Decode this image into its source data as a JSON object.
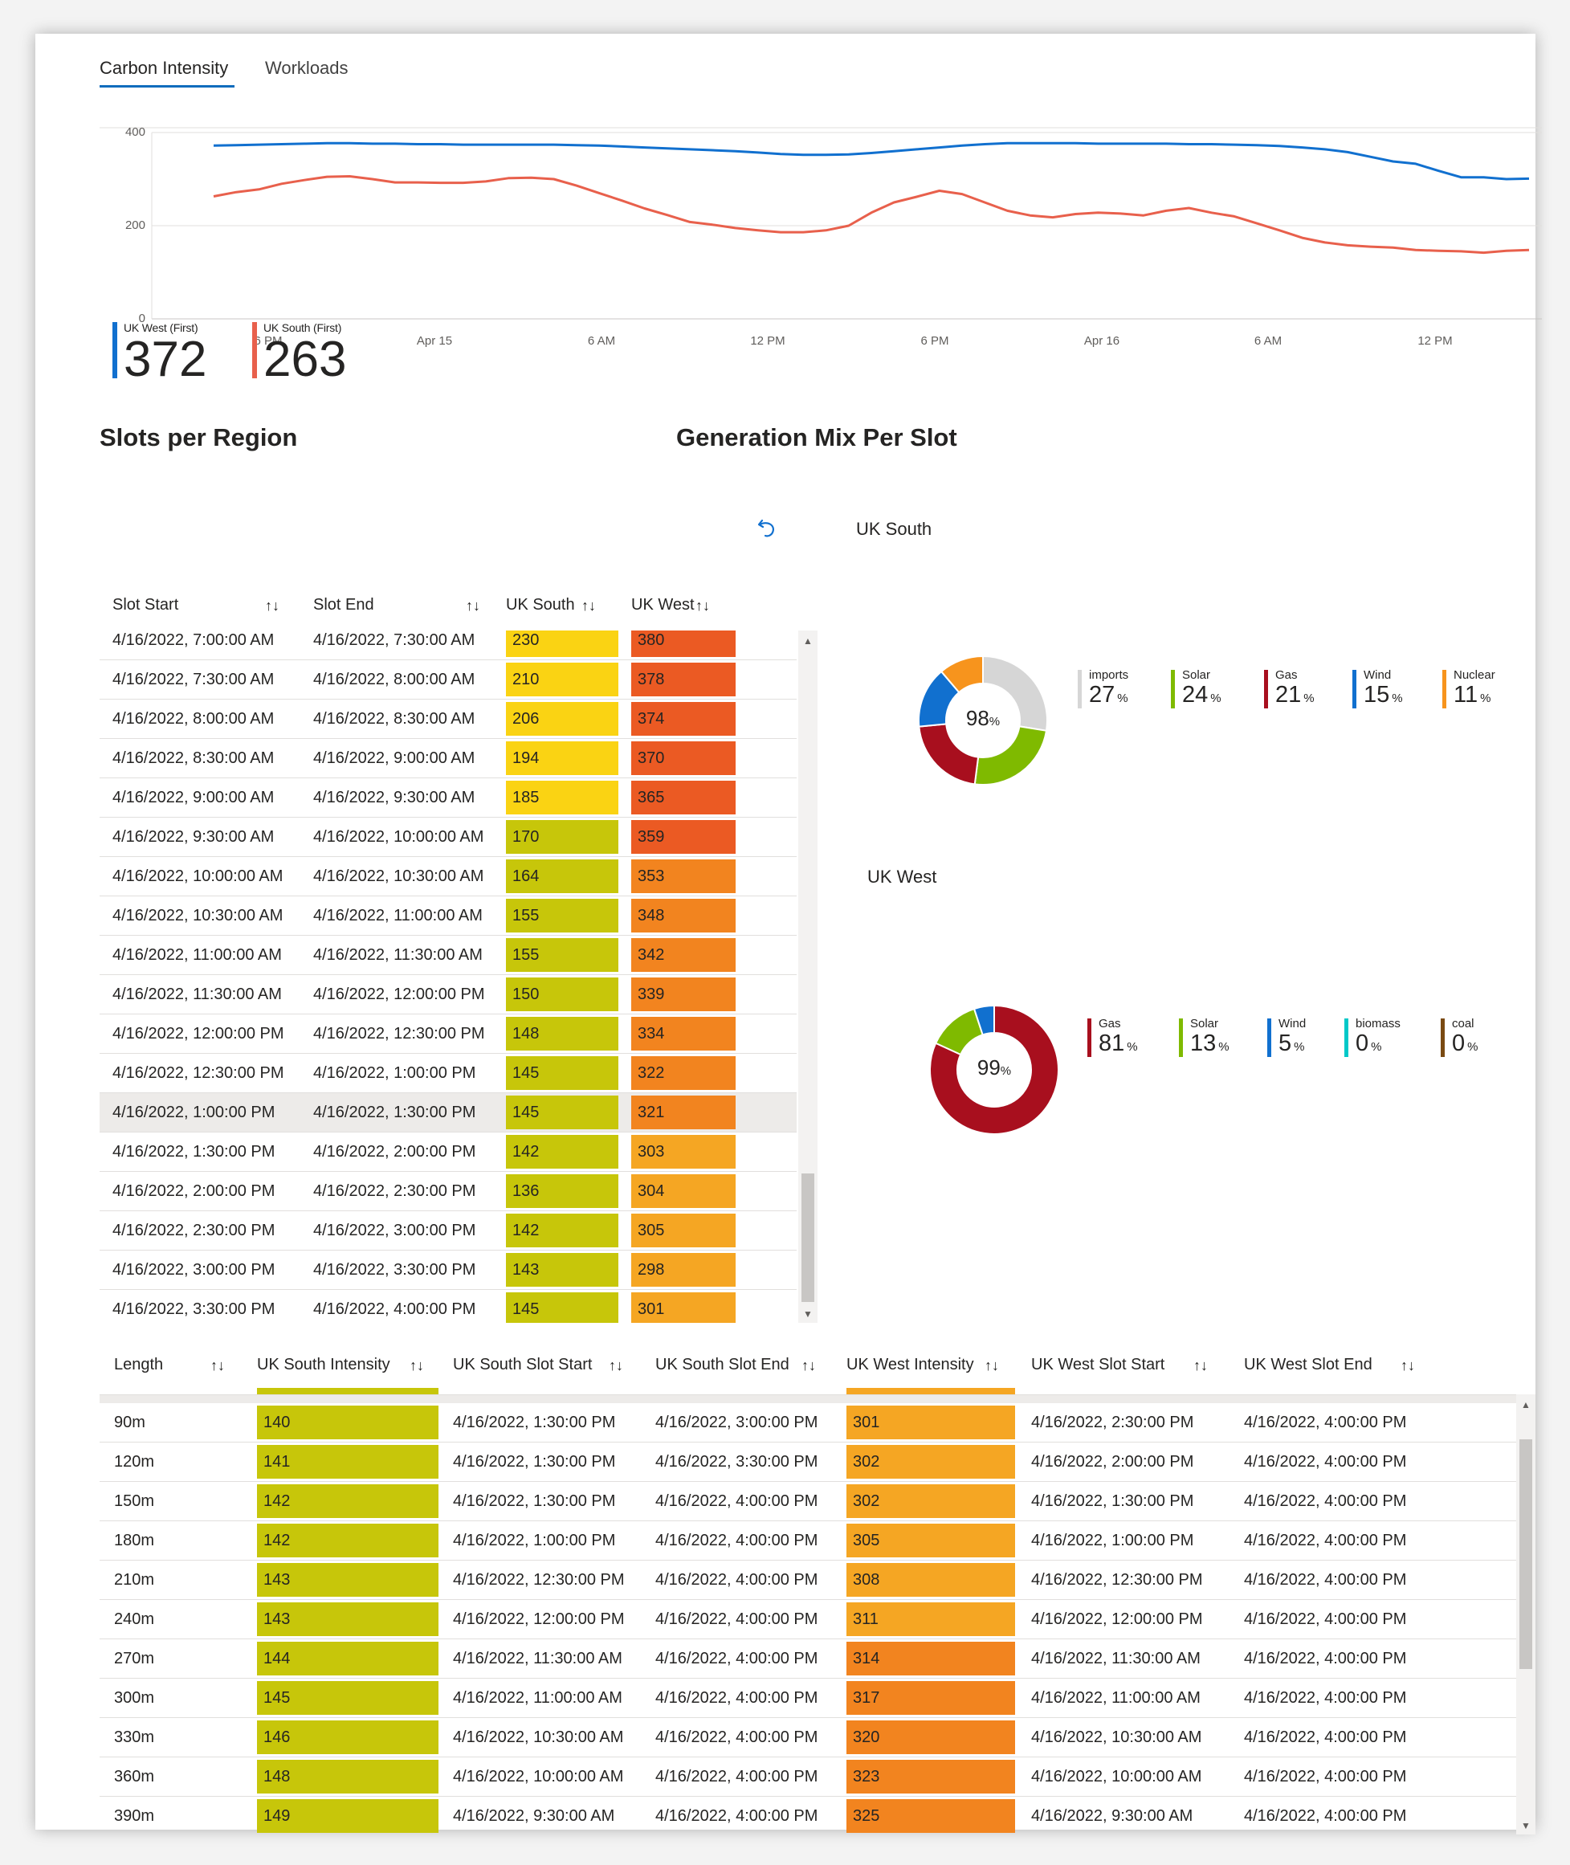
{
  "tabs": [
    {
      "label": "Carbon Intensity"
    },
    {
      "label": "Workloads"
    }
  ],
  "colors": {
    "uk_west": "#1170cf",
    "uk_south": "#e8604c",
    "accent": "#0f6cbd"
  },
  "chart_data": {
    "type": "line",
    "y_ticks": [
      "400",
      "200",
      "0"
    ],
    "ylim": [
      0,
      400
    ],
    "x_ticks": [
      "6 PM",
      "Apr 15",
      "6 AM",
      "12 PM",
      "6 PM",
      "Apr 16",
      "6 AM",
      "12 PM"
    ],
    "grid": true,
    "series": [
      {
        "name": "UK West (First)",
        "color": "#1170cf",
        "values": [
          372,
          373,
          374,
          375,
          376,
          377,
          377,
          376,
          376,
          375,
          375,
          374,
          374,
          374,
          374,
          374,
          373,
          372,
          370,
          368,
          366,
          364,
          362,
          360,
          357,
          354,
          352,
          352,
          353,
          356,
          360,
          364,
          368,
          372,
          375,
          377,
          377,
          377,
          377,
          376,
          376,
          376,
          376,
          375,
          375,
          374,
          373,
          371,
          368,
          364,
          358,
          348,
          338,
          333,
          318,
          304,
          304,
          300,
          301
        ]
      },
      {
        "name": "UK South (First)",
        "color": "#e8604c",
        "values": [
          263,
          272,
          278,
          290,
          298,
          305,
          306,
          300,
          293,
          293,
          292,
          292,
          295,
          302,
          303,
          300,
          286,
          270,
          254,
          237,
          223,
          208,
          202,
          195,
          190,
          186,
          186,
          190,
          200,
          228,
          250,
          262,
          275,
          268,
          250,
          232,
          222,
          218,
          225,
          228,
          226,
          222,
          232,
          238,
          228,
          220,
          205,
          190,
          174,
          164,
          158,
          155,
          153,
          148,
          146,
          145,
          142,
          146,
          148
        ]
      }
    ]
  },
  "kpis": [
    {
      "label": "UK West (First)",
      "value": "372",
      "color": "#1170cf"
    },
    {
      "label": "UK South (First)",
      "value": "263",
      "color": "#e8604c"
    }
  ],
  "sections": {
    "slots_title": "Slots per Region",
    "genmix_title": "Generation Mix Per Slot"
  },
  "reset_icon": "undo-icon",
  "slots_table": {
    "headers": [
      "Slot Start",
      "Slot End",
      "UK South",
      "UK West"
    ],
    "sort_icon": "↑↓",
    "rows": [
      [
        "4/16/2022, 7:00:00 AM",
        "4/16/2022, 7:30:00 AM",
        "230",
        "380",
        "#fad313",
        "#eb5a23"
      ],
      [
        "4/16/2022, 7:30:00 AM",
        "4/16/2022, 8:00:00 AM",
        "210",
        "378",
        "#fad313",
        "#eb5a23"
      ],
      [
        "4/16/2022, 8:00:00 AM",
        "4/16/2022, 8:30:00 AM",
        "206",
        "374",
        "#fad313",
        "#eb5a23"
      ],
      [
        "4/16/2022, 8:30:00 AM",
        "4/16/2022, 9:00:00 AM",
        "194",
        "370",
        "#fad313",
        "#eb5a23"
      ],
      [
        "4/16/2022, 9:00:00 AM",
        "4/16/2022, 9:30:00 AM",
        "185",
        "365",
        "#fad313",
        "#eb5a23"
      ],
      [
        "4/16/2022, 9:30:00 AM",
        "4/16/2022, 10:00:00 AM",
        "170",
        "359",
        "#c7c60a",
        "#eb5a23"
      ],
      [
        "4/16/2022, 10:00:00 AM",
        "4/16/2022, 10:30:00 AM",
        "164",
        "353",
        "#c7c60a",
        "#f2841f"
      ],
      [
        "4/16/2022, 10:30:00 AM",
        "4/16/2022, 11:00:00 AM",
        "155",
        "348",
        "#c7c60a",
        "#f2841f"
      ],
      [
        "4/16/2022, 11:00:00 AM",
        "4/16/2022, 11:30:00 AM",
        "155",
        "342",
        "#c7c60a",
        "#f2841f"
      ],
      [
        "4/16/2022, 11:30:00 AM",
        "4/16/2022, 12:00:00 PM",
        "150",
        "339",
        "#c7c60a",
        "#f2841f"
      ],
      [
        "4/16/2022, 12:00:00 PM",
        "4/16/2022, 12:30:00 PM",
        "148",
        "334",
        "#c7c60a",
        "#f2841f"
      ],
      [
        "4/16/2022, 12:30:00 PM",
        "4/16/2022, 1:00:00 PM",
        "145",
        "322",
        "#c7c60a",
        "#f2841f"
      ],
      [
        "4/16/2022, 1:00:00 PM",
        "4/16/2022, 1:30:00 PM",
        "145",
        "321",
        "#c7c60a",
        "#f2841f"
      ],
      [
        "4/16/2022, 1:30:00 PM",
        "4/16/2022, 2:00:00 PM",
        "142",
        "303",
        "#c7c60a",
        "#f5a623"
      ],
      [
        "4/16/2022, 2:00:00 PM",
        "4/16/2022, 2:30:00 PM",
        "136",
        "304",
        "#c7c60a",
        "#f5a623"
      ],
      [
        "4/16/2022, 2:30:00 PM",
        "4/16/2022, 3:00:00 PM",
        "142",
        "305",
        "#c7c60a",
        "#f5a623"
      ],
      [
        "4/16/2022, 3:00:00 PM",
        "4/16/2022, 3:30:00 PM",
        "143",
        "298",
        "#c7c60a",
        "#f5a623"
      ],
      [
        "4/16/2022, 3:30:00 PM",
        "4/16/2022, 4:00:00 PM",
        "145",
        "301",
        "#c7c60a",
        "#f5a623"
      ]
    ],
    "highlighted_row": 12
  },
  "donuts": [
    {
      "title": "UK South",
      "center": "98",
      "center_unit": "%",
      "segments": [
        {
          "name": "imports",
          "value": 27,
          "color": "#d6d6d6"
        },
        {
          "name": "Solar",
          "value": 24,
          "color": "#7fba00"
        },
        {
          "name": "Gas",
          "value": 21,
          "color": "#a80f1e"
        },
        {
          "name": "Wind",
          "value": 15,
          "color": "#1170cf"
        },
        {
          "name": "Nuclear",
          "value": 11,
          "color": "#f7941d"
        }
      ]
    },
    {
      "title": "UK West",
      "center": "99",
      "center_unit": "%",
      "segments": [
        {
          "name": "Gas",
          "value": 81,
          "color": "#a80f1e"
        },
        {
          "name": "Solar",
          "value": 13,
          "color": "#7fba00"
        },
        {
          "name": "Wind",
          "value": 5,
          "color": "#1170cf"
        },
        {
          "name": "biomass",
          "value": 0,
          "color": "#00c8c8"
        },
        {
          "name": "coal",
          "value": 0,
          "color": "#7a4a12"
        }
      ]
    }
  ],
  "pct_sign": "%",
  "length_table": {
    "headers": [
      "Length",
      "UK South Intensity",
      "UK South Slot Start",
      "UK South Slot End",
      "UK West Intensity",
      "UK West Slot Start",
      "UK West Slot End"
    ],
    "rows": [
      [
        "90m",
        "140",
        "4/16/2022, 1:30:00 PM",
        "4/16/2022, 3:00:00 PM",
        "301",
        "4/16/2022, 2:30:00 PM",
        "4/16/2022, 4:00:00 PM",
        "#f5a623"
      ],
      [
        "120m",
        "141",
        "4/16/2022, 1:30:00 PM",
        "4/16/2022, 3:30:00 PM",
        "302",
        "4/16/2022, 2:00:00 PM",
        "4/16/2022, 4:00:00 PM",
        "#f5a623"
      ],
      [
        "150m",
        "142",
        "4/16/2022, 1:30:00 PM",
        "4/16/2022, 4:00:00 PM",
        "302",
        "4/16/2022, 1:30:00 PM",
        "4/16/2022, 4:00:00 PM",
        "#f5a623"
      ],
      [
        "180m",
        "142",
        "4/16/2022, 1:00:00 PM",
        "4/16/2022, 4:00:00 PM",
        "305",
        "4/16/2022, 1:00:00 PM",
        "4/16/2022, 4:00:00 PM",
        "#f5a623"
      ],
      [
        "210m",
        "143",
        "4/16/2022, 12:30:00 PM",
        "4/16/2022, 4:00:00 PM",
        "308",
        "4/16/2022, 12:30:00 PM",
        "4/16/2022, 4:00:00 PM",
        "#f5a623"
      ],
      [
        "240m",
        "143",
        "4/16/2022, 12:00:00 PM",
        "4/16/2022, 4:00:00 PM",
        "311",
        "4/16/2022, 12:00:00 PM",
        "4/16/2022, 4:00:00 PM",
        "#f5a623"
      ],
      [
        "270m",
        "144",
        "4/16/2022, 11:30:00 AM",
        "4/16/2022, 4:00:00 PM",
        "314",
        "4/16/2022, 11:30:00 AM",
        "4/16/2022, 4:00:00 PM",
        "#f2841f"
      ],
      [
        "300m",
        "145",
        "4/16/2022, 11:00:00 AM",
        "4/16/2022, 4:00:00 PM",
        "317",
        "4/16/2022, 11:00:00 AM",
        "4/16/2022, 4:00:00 PM",
        "#f2841f"
      ],
      [
        "330m",
        "146",
        "4/16/2022, 10:30:00 AM",
        "4/16/2022, 4:00:00 PM",
        "320",
        "4/16/2022, 10:30:00 AM",
        "4/16/2022, 4:00:00 PM",
        "#f2841f"
      ],
      [
        "360m",
        "148",
        "4/16/2022, 10:00:00 AM",
        "4/16/2022, 4:00:00 PM",
        "323",
        "4/16/2022, 10:00:00 AM",
        "4/16/2022, 4:00:00 PM",
        "#f2841f"
      ],
      [
        "390m",
        "149",
        "4/16/2022, 9:30:00 AM",
        "4/16/2022, 4:00:00 PM",
        "325",
        "4/16/2022, 9:30:00 AM",
        "4/16/2022, 4:00:00 PM",
        "#f2841f"
      ]
    ],
    "south_color": "#c7c60a"
  }
}
